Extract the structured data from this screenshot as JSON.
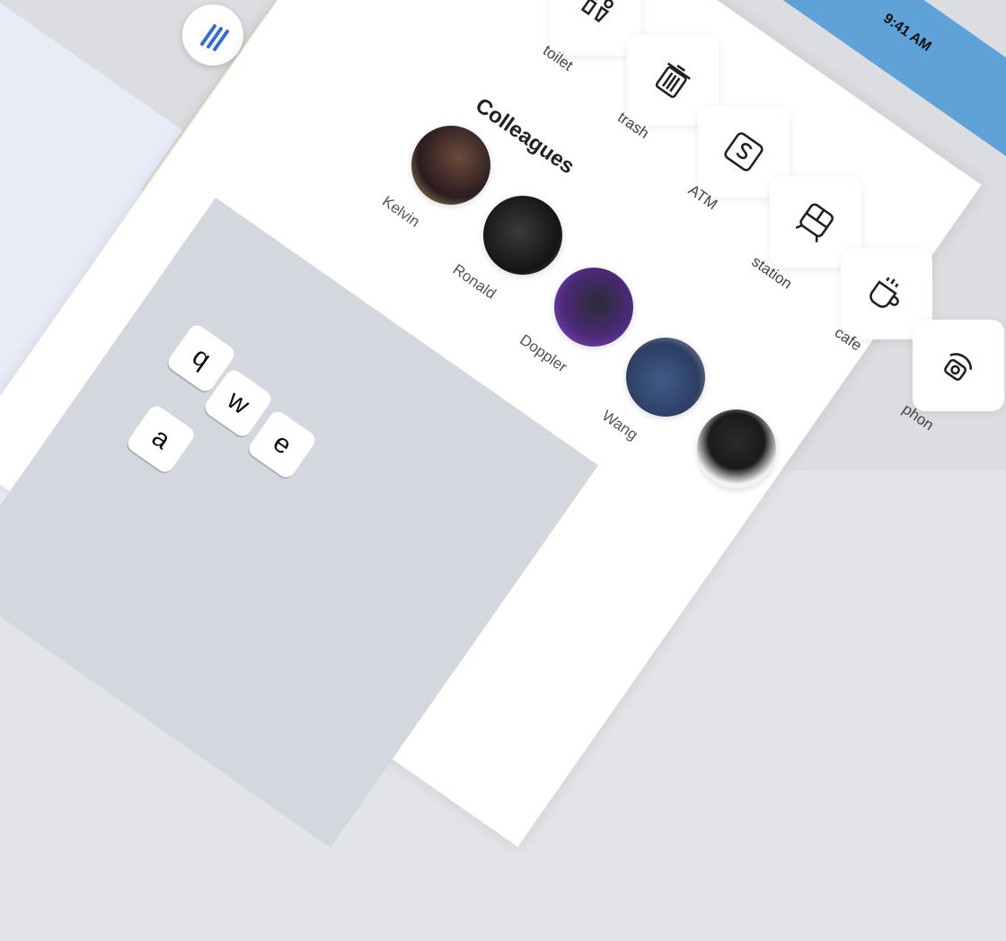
{
  "status": {
    "time": "9:41 AM"
  },
  "map": {
    "menu_icon": "menu-lines-icon",
    "blue_accent": "#2f6fd6",
    "green_zone": "#e6edd6"
  },
  "panel": {
    "amenities": [
      {
        "label": "toilet",
        "icon": "toilet-icon"
      },
      {
        "label": "trash",
        "icon": "trash-icon"
      },
      {
        "label": "ATM",
        "icon": "atm-icon"
      },
      {
        "label": "station",
        "icon": "station-icon"
      },
      {
        "label": "cafe",
        "icon": "cafe-icon"
      },
      {
        "label": "phon",
        "icon": "phone-icon"
      }
    ],
    "colleagues_title": "Colleagues",
    "colleagues": [
      {
        "name": "Kelvin"
      },
      {
        "name": "Ronald"
      },
      {
        "name": "Doppler"
      },
      {
        "name": "Wang"
      }
    ]
  },
  "keyboard": {
    "row1": [
      "q",
      "w",
      "e"
    ],
    "row2": [
      "a"
    ]
  }
}
